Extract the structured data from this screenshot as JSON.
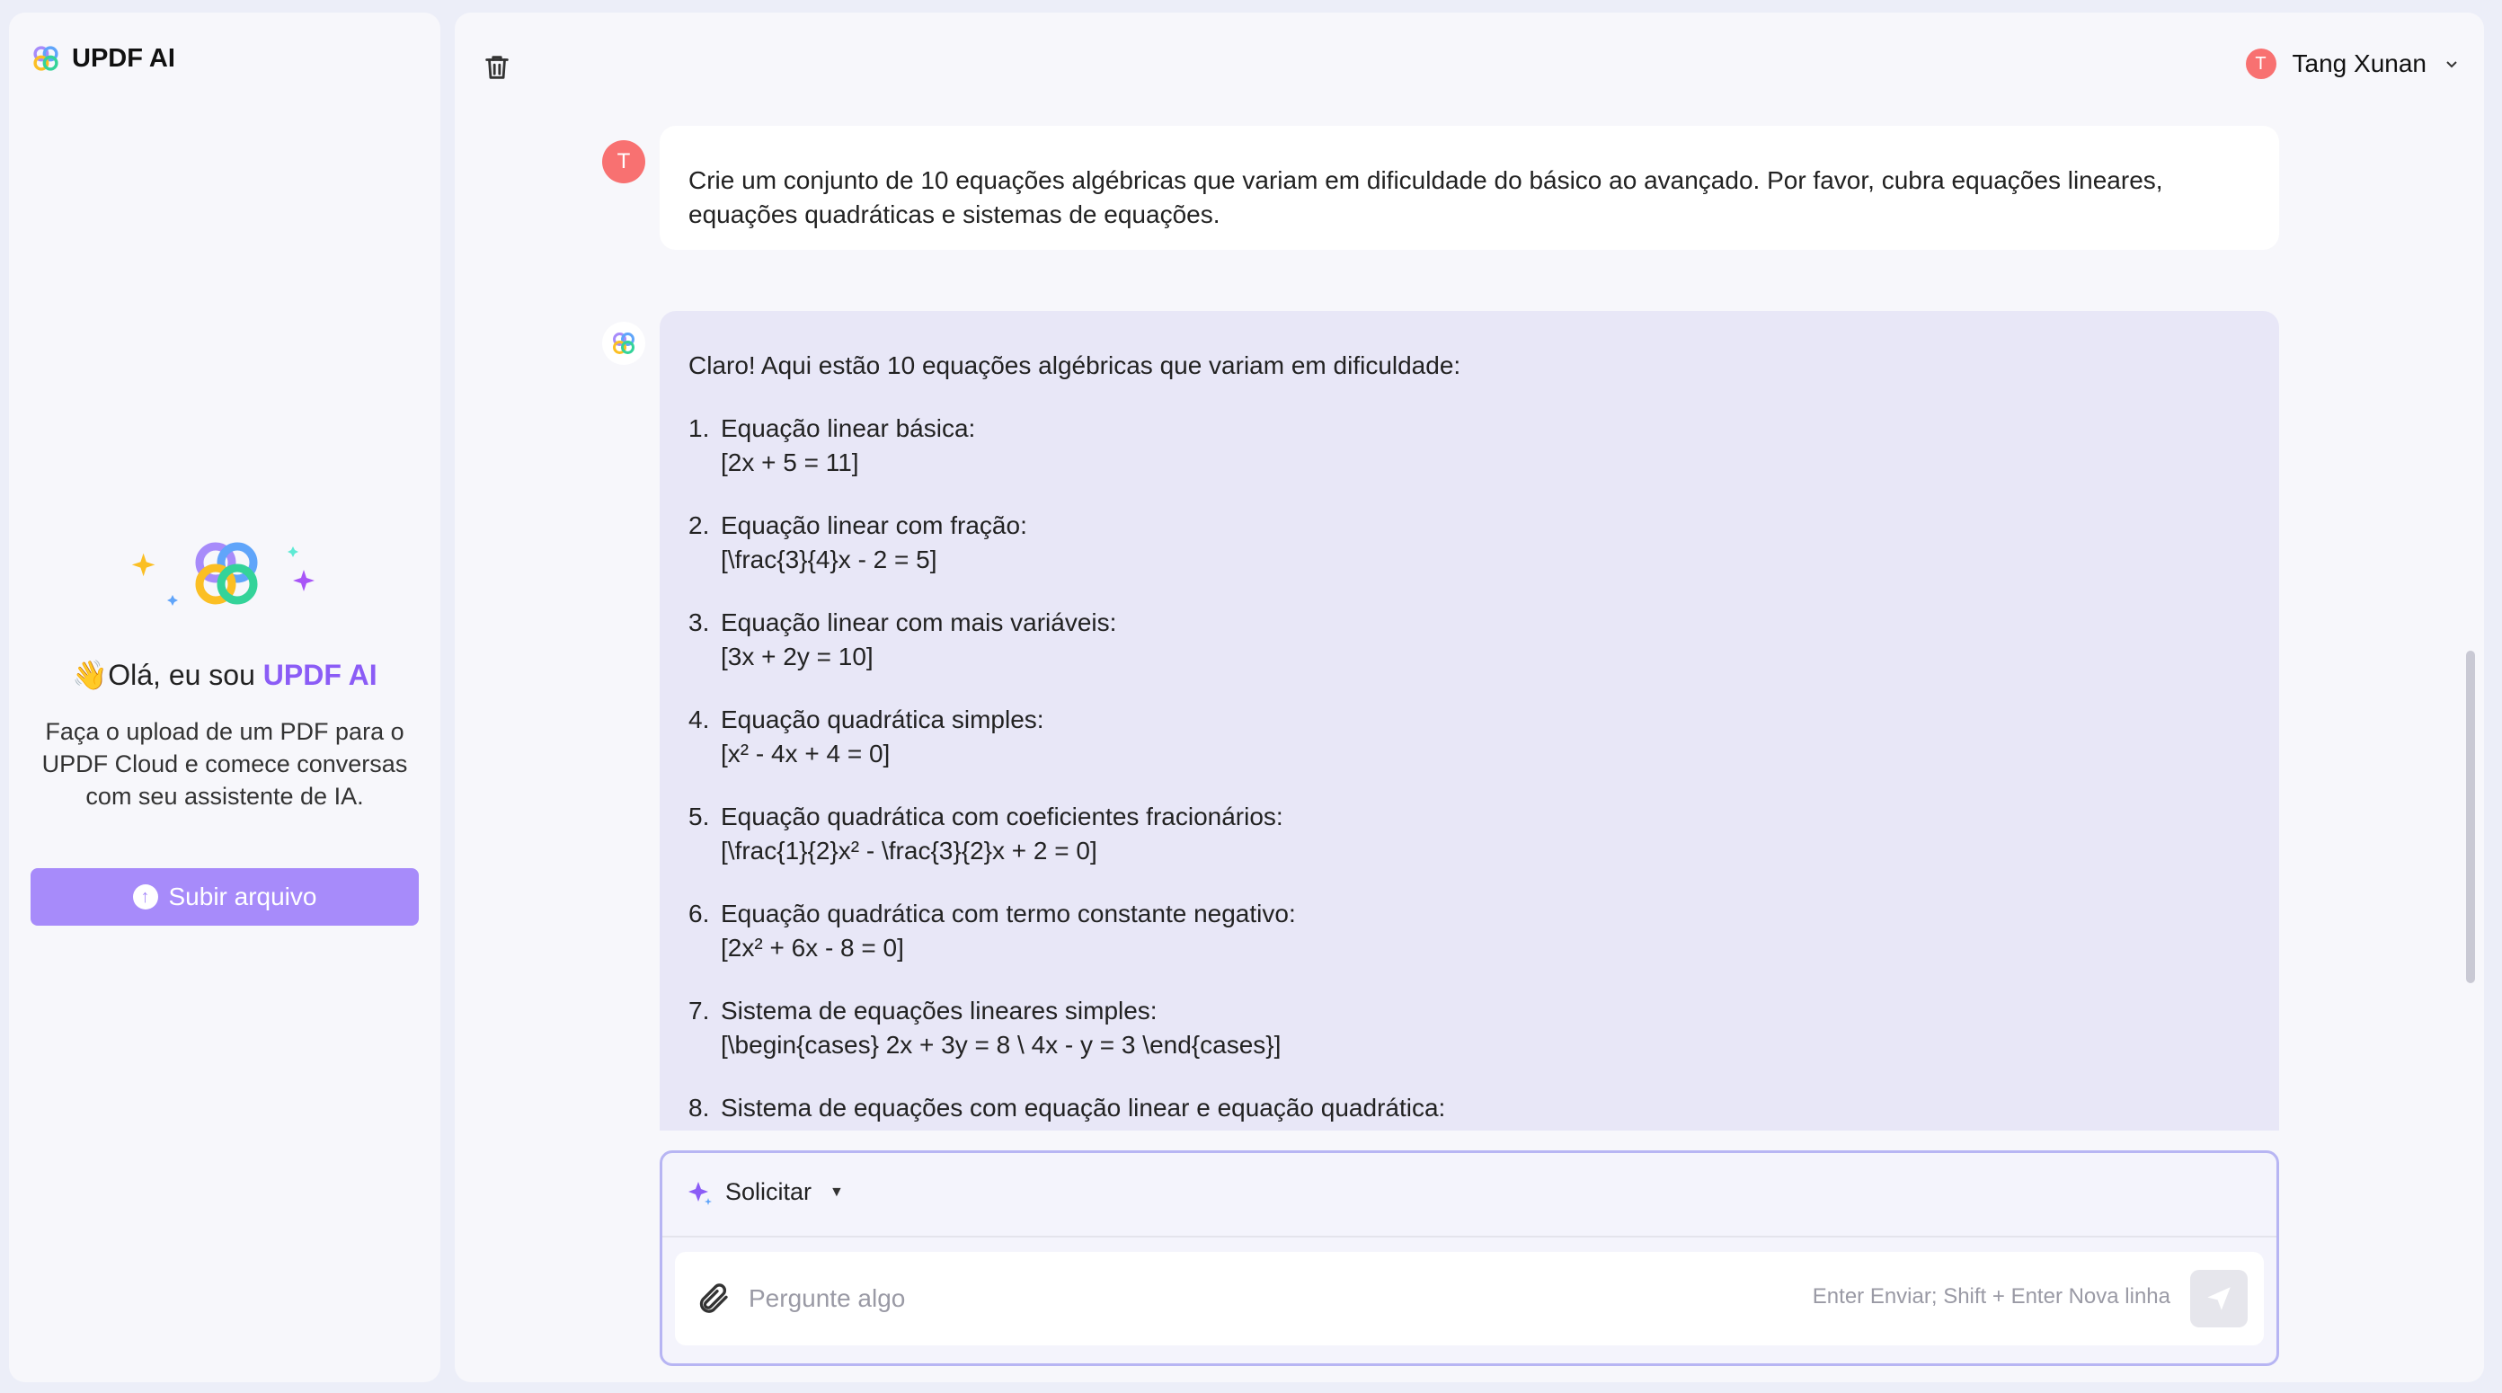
{
  "sidebar": {
    "brand_name": "UPDF AI",
    "greeting_prefix": "👋Olá, eu sou ",
    "greeting_highlight": "UPDF AI",
    "intro": "Faça o upload de um PDF para o UPDF Cloud e comece conversas com seu assistente de IA.",
    "upload_label": "Subir arquivo",
    "upload_icon": "arrow-up-circle-icon"
  },
  "header": {
    "user_initial": "T",
    "user_name": "Tang Xunan"
  },
  "chat": {
    "user_initial": "T",
    "user_message": "Crie um conjunto de 10 equações algébricas que variam em dificuldade do básico ao avançado. Por favor, cubra equações lineares, equações quadráticas e sistemas de equações.",
    "ai_intro": "Claro! Aqui estão 10 equações algébricas que variam em dificuldade:",
    "items": [
      {
        "num": "1.",
        "title": "Equação linear básica:",
        "eq": "[2x + 5 = 11]"
      },
      {
        "num": "2.",
        "title": "Equação linear com fração:",
        "eq": "[\\frac{3}{4}x - 2 = 5]"
      },
      {
        "num": "3.",
        "title": "Equação linear com mais variáveis:",
        "eq": "[3x + 2y = 10]"
      },
      {
        "num": "4.",
        "title": "Equação quadrática simples:",
        "eq": "[x² - 4x + 4 = 0]"
      },
      {
        "num": "5.",
        "title": "Equação quadrática com coeficientes fracionários:",
        "eq": "[\\frac{1}{2}x² - \\frac{3}{2}x + 2 = 0]"
      },
      {
        "num": "6.",
        "title": "Equação quadrática com termo constante negativo:",
        "eq": "[2x² + 6x - 8 = 0]"
      },
      {
        "num": "7.",
        "title": "Sistema de equações lineares simples:",
        "eq": "[\\begin{cases} 2x + 3y = 8 \\ 4x - y = 3 \\end{cases}]"
      },
      {
        "num": "8.",
        "title": "Sistema de equações com equação linear e equação quadrática:",
        "eq": ""
      }
    ]
  },
  "composer": {
    "prompt_label": "Solicitar",
    "placeholder": "Pergunte algo",
    "hint": "Enter Enviar; Shift + Enter Nova linha"
  },
  "colors": {
    "accent": "#8b5cf6",
    "button": "#a78bfa",
    "ai_bubble": "#e8e7f7",
    "avatar": "#f87171"
  }
}
